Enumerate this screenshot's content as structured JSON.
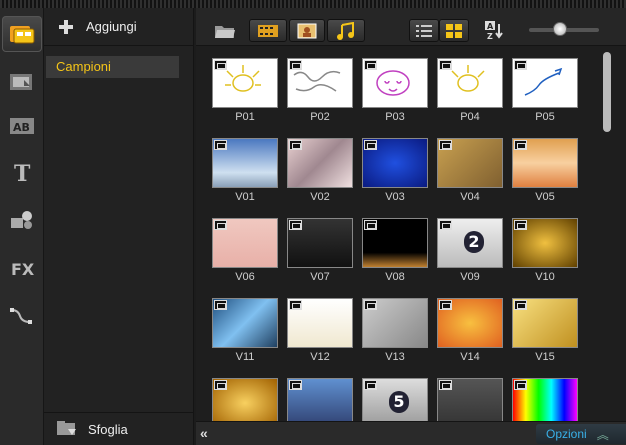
{
  "library": {
    "add_label": "Aggiungi",
    "items": [
      {
        "label": "Campioni",
        "selected": true
      }
    ],
    "browse_label": "Sfoglia"
  },
  "rail": [
    "media-icon",
    "transition-icon",
    "title-icon",
    "text-icon",
    "graphic-icon",
    "fx-icon",
    "motion-path-icon"
  ],
  "toolbar": {
    "icons": [
      "folder-icon",
      "video-filter-icon",
      "photo-filter-icon",
      "audio-filter-icon",
      "list-view-icon",
      "thumbnail-view-icon",
      "sort-icon"
    ],
    "zoom_level": 0.5
  },
  "thumbnails": [
    {
      "label": "P01",
      "kind": "photo"
    },
    {
      "label": "P02",
      "kind": "photo"
    },
    {
      "label": "P03",
      "kind": "photo"
    },
    {
      "label": "P04",
      "kind": "photo"
    },
    {
      "label": "P05",
      "kind": "photo"
    },
    {
      "label": "V01",
      "kind": "video"
    },
    {
      "label": "V02",
      "kind": "video"
    },
    {
      "label": "V03",
      "kind": "video"
    },
    {
      "label": "V04",
      "kind": "video"
    },
    {
      "label": "V05",
      "kind": "video"
    },
    {
      "label": "V06",
      "kind": "video"
    },
    {
      "label": "V07",
      "kind": "video"
    },
    {
      "label": "V08",
      "kind": "video"
    },
    {
      "label": "V09",
      "kind": "video",
      "overlay": "2"
    },
    {
      "label": "V10",
      "kind": "video"
    },
    {
      "label": "V11",
      "kind": "video"
    },
    {
      "label": "V12",
      "kind": "video"
    },
    {
      "label": "V13",
      "kind": "video"
    },
    {
      "label": "V14",
      "kind": "video"
    },
    {
      "label": "V15",
      "kind": "video"
    },
    {
      "label": "",
      "kind": "video"
    },
    {
      "label": "",
      "kind": "video"
    },
    {
      "label": "",
      "kind": "video",
      "overlay": "5"
    },
    {
      "label": "",
      "kind": "video"
    },
    {
      "label": "",
      "kind": "video"
    }
  ],
  "bottom": {
    "options_label": "Opzioni"
  },
  "colors": {
    "accent": "#f5c518",
    "options_text": "#39b0e8"
  }
}
